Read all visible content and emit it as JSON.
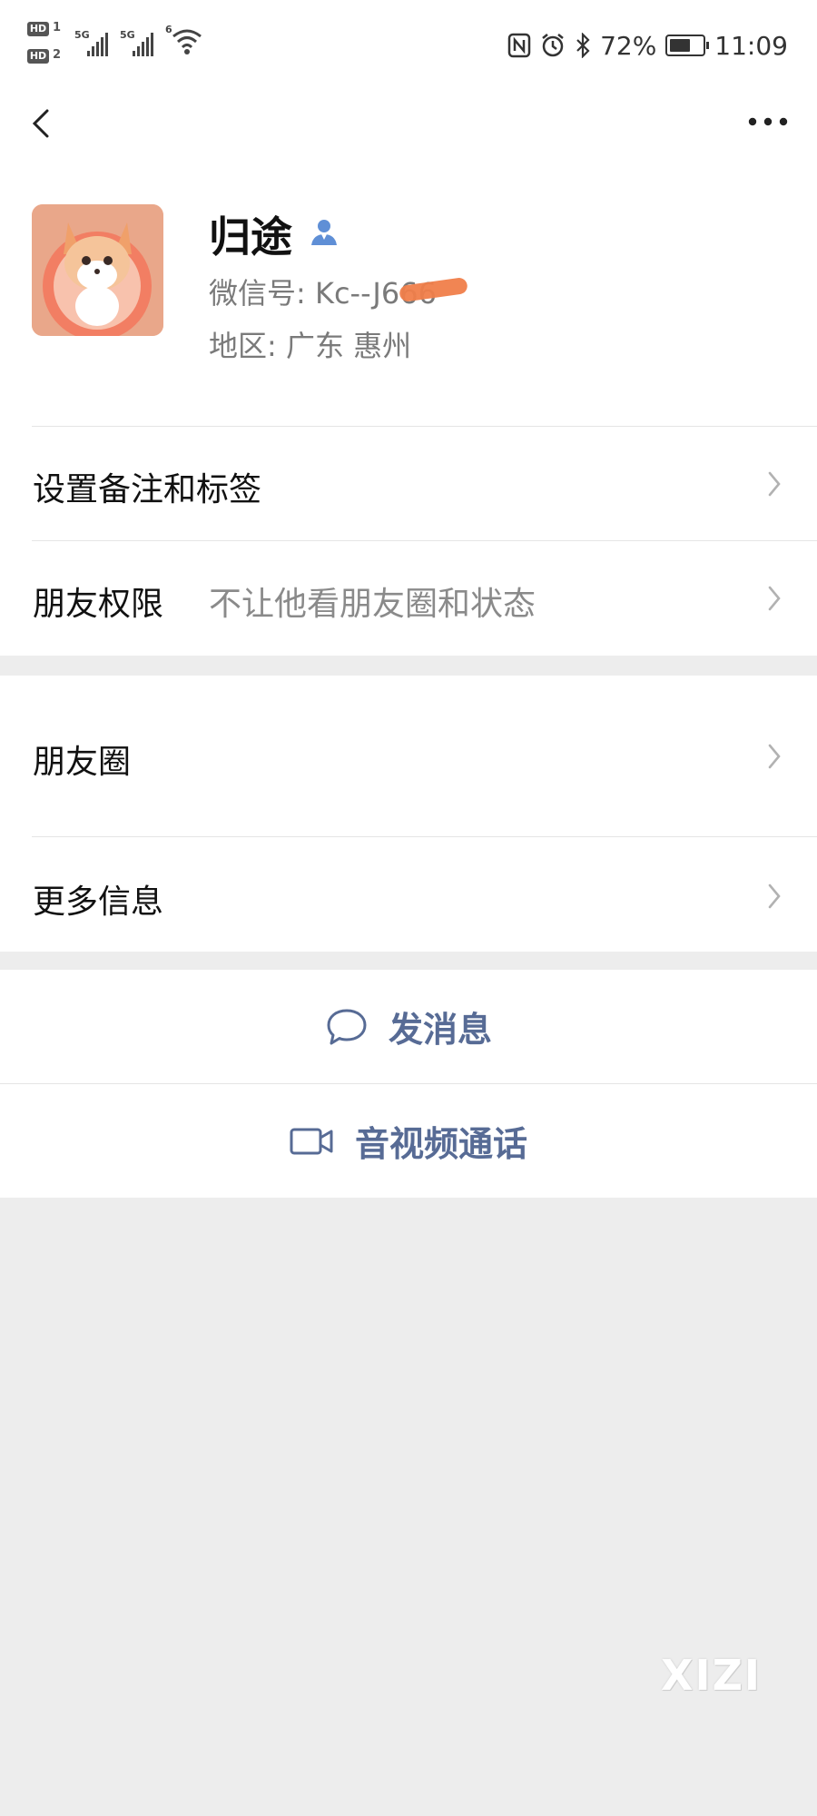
{
  "status_bar": {
    "sim1_badge": "HD",
    "sim1_num": "1",
    "sim2_badge": "HD",
    "sim2_num": "2",
    "net1": "5G",
    "net2": "5G",
    "wifi_label": "6",
    "battery": "72%",
    "battery_level": 0.72,
    "time": "11:09"
  },
  "nav": {
    "back_icon": "chevron-left-icon",
    "more_icon": "more-dots-icon"
  },
  "profile": {
    "name": "归途",
    "wechat_id": "微信号: Kc--J666",
    "region": "地区: 广东  惠州",
    "avatar": "fox-avatar"
  },
  "cells": {
    "remark_label": "设置备注和标签",
    "permission_label": "朋友权限",
    "permission_value": "不让他看朋友圈和状态",
    "moments_label": "朋友圈",
    "more_info_label": "更多信息"
  },
  "actions": {
    "message_label": "发消息",
    "call_label": "音视频通话"
  },
  "watermark": "XIZI",
  "colors": {
    "link_blue": "#576b95",
    "background": "#ededed",
    "redaction": "#f07e4a"
  }
}
